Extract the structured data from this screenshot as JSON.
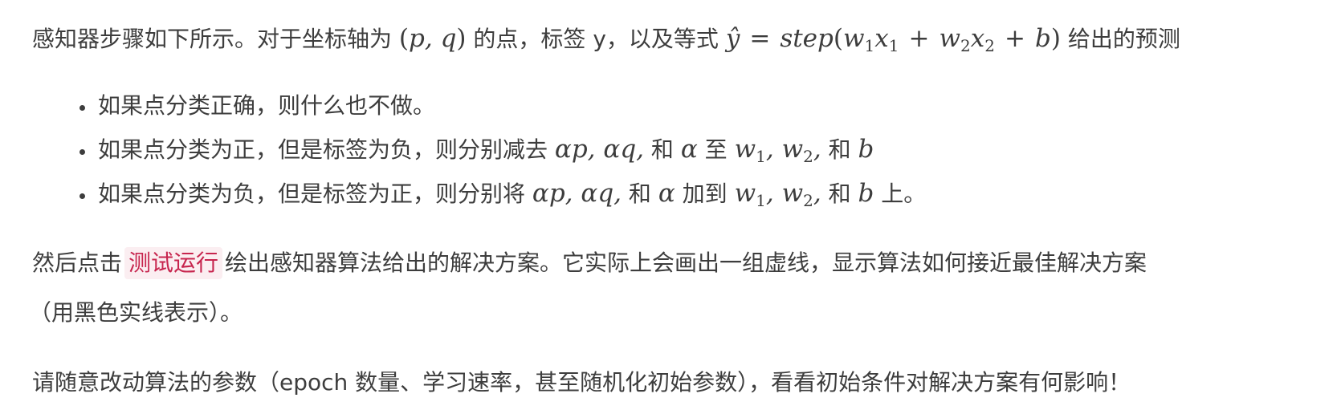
{
  "intro": {
    "text_before": "感知器步骤如下所示。对于坐标轴为 ",
    "point_math": "(p, q)",
    "text_middle": " 的点，标签 y，以及等式 ",
    "equation_math": "ŷ = step(w₁x₁ + w₂x₂ + b)",
    "text_after": " 给出的预测"
  },
  "bullets": [
    {
      "text": "如果点分类正确，则什么也不做。"
    },
    {
      "text_before": "如果点分类为正，但是标签为负，则分别减去 ",
      "math_a": "αp, αq,",
      "text_and": " 和 ",
      "math_alpha": "α",
      "text_to": " 至 ",
      "math_w": "w₁, w₂,",
      "text_and2": " 和 ",
      "math_b": "b",
      "text_end": ""
    },
    {
      "text_before": "如果点分类为负，但是标签为正，则分别将 ",
      "math_a": "αp, αq,",
      "text_and": " 和 ",
      "math_alpha": "α",
      "text_to": " 加到 ",
      "math_w": "w₁, w₂,",
      "text_and2": " 和 ",
      "math_b": "b",
      "text_end": " 上。"
    }
  ],
  "run_paragraph": {
    "text_before": "然后点击",
    "link_label": "测试运行",
    "text_after_line1": "绘出感知器算法给出的解决方案。它实际上会画出一组虚线，显示算法如何接近最佳解决方案",
    "text_line2": "（用黑色实线表示）。"
  },
  "closing_paragraph": {
    "text": "请随意改动算法的参数（epoch 数量、学习速率，甚至随机化初始参数），看看初始条件对解决方案有何影响！"
  }
}
